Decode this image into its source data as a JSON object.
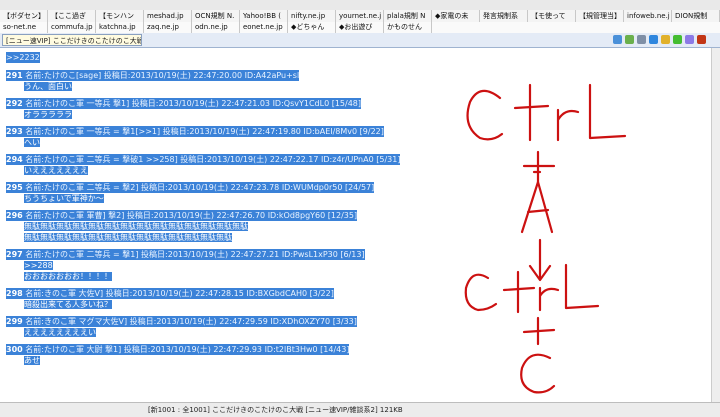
{
  "bookmarks_row1": [
    "【ボダセン】",
    "【ここ過ぎ",
    "【モンハン",
    "meshad.jp",
    "OCN規制 N.",
    "Yahoo!BB (",
    "nifty.ne.jp",
    "yournet.ne.j",
    "plala規制 N",
    "◆家電の未",
    "発言規制系",
    "【モ使って",
    "【規管理当】",
    "infoweb.ne.j",
    "DION規制"
  ],
  "bookmarks_row2": [
    "so-net.ne",
    "commufa.jp",
    "katchna.jp",
    "zaq.ne.jp",
    "odn.ne.jp",
    "eonet.ne.jp",
    "◆どちゃん",
    "◆お出遊び",
    "かものせん"
  ],
  "tab": {
    "title": "[ニュー速VIP] ここだけきのこたけのこ大戦"
  },
  "posts": [
    {
      "num": "",
      "header": ">>2232",
      "lines": []
    },
    {
      "num": "291",
      "header": "名前:たけのこ[sage] 投稿日:2013/10/19(土) 22:47:20.00 ID:A42aPu+sl",
      "lines": [
        "うん、面白い"
      ]
    },
    {
      "num": "292",
      "header": "名前:たけのこ軍 一等兵 撃1] 投稿日:2013/10/19(土) 22:47:21.03 ID:QsvY1CdL0 [15/48]",
      "lines": [
        "オラララララ"
      ]
    },
    {
      "num": "293",
      "header": "名前:たけのこ軍 一等兵 = 撃1[>>1] 投稿日:2013/10/19(土) 22:47:19.80 ID:bAEI/8Mv0 [9/22]",
      "lines": [
        "へい"
      ]
    },
    {
      "num": "294",
      "header": "名前:たけのこ軍 二等兵 = 撃破1 >>258] 投稿日:2013/10/19(土) 22:47:22.17 ID:z4r/UPnA0 [5/31]",
      "lines": [
        "いえええええええ"
      ]
    },
    {
      "num": "295",
      "header": "名前:たけのこ軍 二等兵 = 撃2] 投稿日:2013/10/19(土) 22:47:23.78 ID:WUMdp0r50 [24/57]",
      "lines": [
        "ちうちょいで軍神か〜"
      ]
    },
    {
      "num": "296",
      "header": "名前:たけのこ軍 軍曹] 撃2] 投稿日:2013/10/19(土) 22:47:26.70 ID:kOd8pgY60 [12/35]",
      "lines": [
        "無駄無駄無駄無駄無駄無駄無駄無駄無駄無駄無駄無駄無駄無駄",
        "無駄無駄無駄無駄無駄無駄無駄無駄無駄無駄無駄無駄無駄"
      ]
    },
    {
      "num": "297",
      "header": "名前:たけのこ軍 二等兵 = 撃1] 投稿日:2013/10/19(土) 22:47:27.21 ID:PwsL1xP30 [6/13]",
      "lines": [
        ">>288",
        "おおおおおおお！！！！"
      ]
    },
    {
      "num": "298",
      "header": "名前:きのこ軍 大佐Ⅴ] 投稿日:2013/10/19(土) 22:47:28.15 ID:BXGbdCAH0 [3/22]",
      "lines": [
        "暗殺出来てる人多いね？"
      ]
    },
    {
      "num": "299",
      "header": "名前:きのこ軍 マグマ大佐Ⅴ] 投稿日:2013/10/19(土) 22:47:29.59 ID:XDhOXZY70 [3/33]",
      "lines": [
        "ええええええええい"
      ]
    },
    {
      "num": "300",
      "header": "名前:たけのこ軍 大尉 撃1] 投稿日:2013/10/19(土) 22:47:29.93 ID:t2lBt3Hw0 [14/43]",
      "lines": [
        "あせ"
      ]
    }
  ],
  "status": {
    "text": "[新1001 : 全1001] ここだけきのこたけのこ大戦 [ニュー速VIP/雑談系2] 121KB"
  },
  "annotation": {
    "lines": [
      "CtrL",
      "+",
      "A",
      "↓",
      "CtrL",
      "+",
      "C"
    ],
    "color": "#cc1111"
  }
}
